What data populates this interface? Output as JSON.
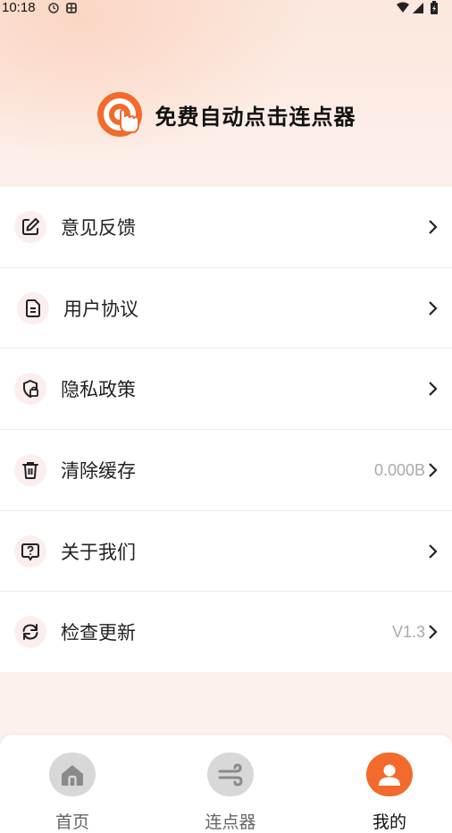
{
  "status_bar": {
    "time": "10:18"
  },
  "app": {
    "title": "免费自动点击连点器"
  },
  "menu": [
    {
      "label": "意见反馈",
      "value": "",
      "icon": "edit-icon"
    },
    {
      "label": "用户协议",
      "value": "",
      "icon": "document-icon"
    },
    {
      "label": "隐私政策",
      "value": "",
      "icon": "shield-lock-icon"
    },
    {
      "label": "清除缓存",
      "value": "0.000B",
      "icon": "trash-icon"
    },
    {
      "label": "关于我们",
      "value": "",
      "icon": "question-icon"
    },
    {
      "label": "检查更新",
      "value": "V1.3",
      "icon": "refresh-icon"
    }
  ],
  "bottom_nav": [
    {
      "label": "首页",
      "icon": "home-icon",
      "active": false
    },
    {
      "label": "连点器",
      "icon": "wind-icon",
      "active": false
    },
    {
      "label": "我的",
      "icon": "user-icon",
      "active": true
    }
  ],
  "colors": {
    "accent": "#f26b2c",
    "icon_circle_bg": "#fdeeee",
    "inactive_nav": "#d8d8d8"
  }
}
